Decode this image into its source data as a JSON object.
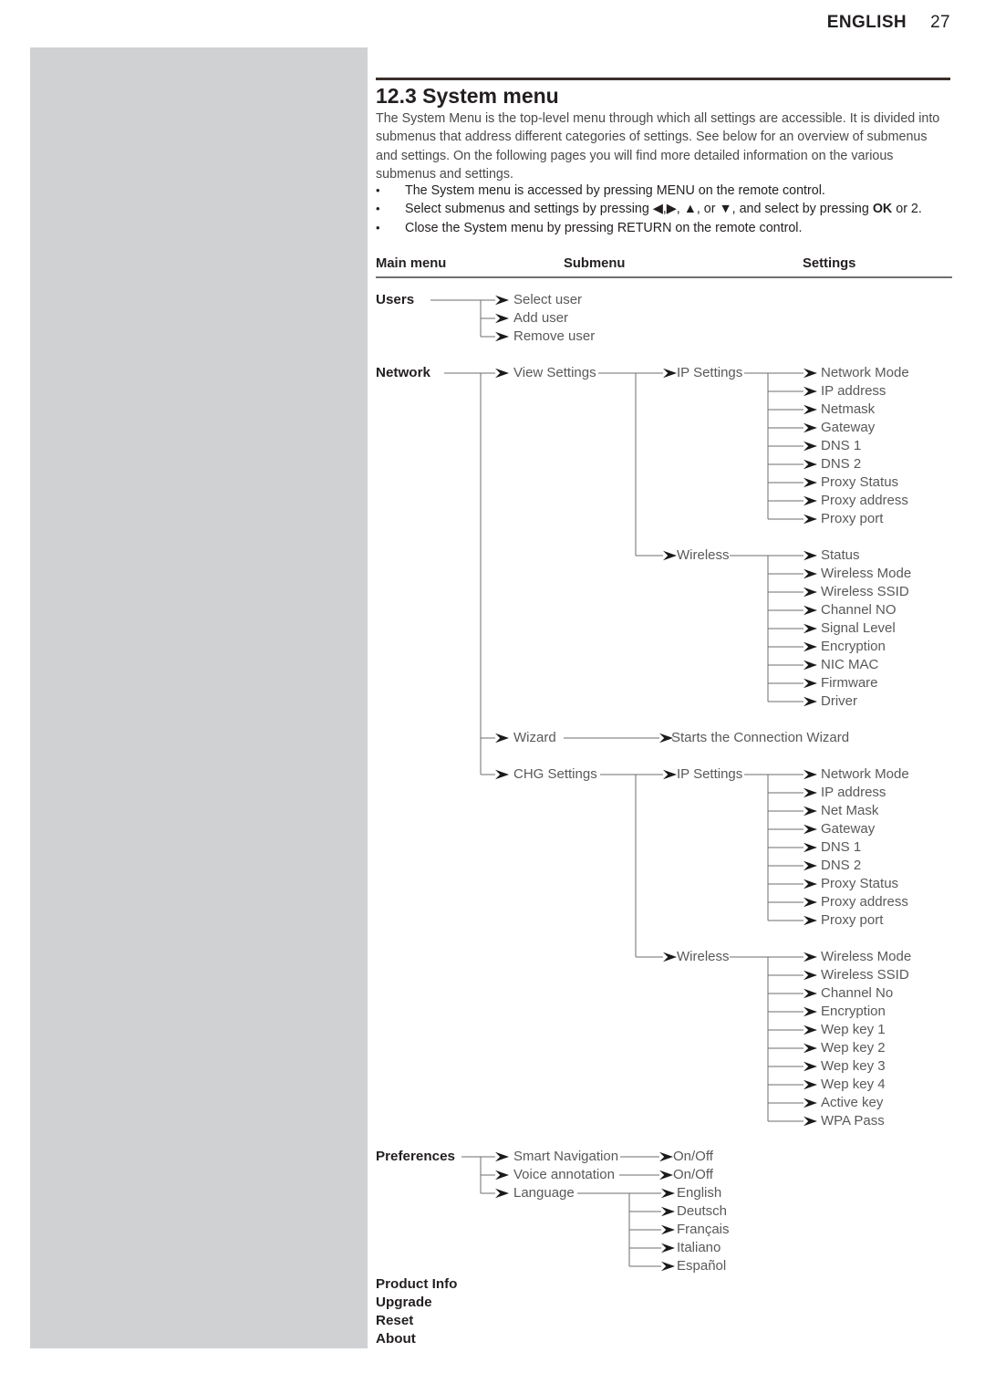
{
  "header": {
    "language_label": "ENGLISH",
    "page_number": "27"
  },
  "section": {
    "number_title": "12.3 System menu",
    "intro": "The System Menu is the top-level menu through which all settings are accessible. It is divided into submenus that address different categories of settings. See below for an overview of submenus and settings. On the following pages you will find more detailed information on the various submenus and settings.",
    "bullets": [
      {
        "bullet": "•",
        "html": "The System menu is accessed by pressing MENU on the remote control."
      },
      {
        "bullet": "•",
        "html": "Select submenus and settings by pressing ◀,▶, ▲, or ▼, and select by pressing <b>OK</b> or 2."
      },
      {
        "bullet": "•",
        "html": "Close the System menu by pressing RETURN on the remote control."
      }
    ]
  },
  "table": {
    "columns": [
      "Main menu",
      "Submenu",
      "Settings"
    ]
  },
  "menu_tree": {
    "users": {
      "label": "Users",
      "children": [
        "Select user",
        "Add user",
        "Remove user"
      ]
    },
    "network": {
      "label": "Network",
      "view_settings": {
        "label": "View Settings",
        "ip_settings": {
          "label": "IP Settings",
          "children": [
            "Network Mode",
            "IP address",
            "Netmask",
            "Gateway",
            "DNS 1",
            "DNS 2",
            "Proxy Status",
            "Proxy address",
            "Proxy port"
          ]
        },
        "wireless": {
          "label": "Wireless",
          "children": [
            "Status",
            "Wireless Mode",
            "Wireless SSID",
            "Channel NO",
            "Signal Level",
            "Encryption",
            "NIC MAC",
            "Firmware",
            "Driver"
          ]
        }
      },
      "wizard": {
        "label": "Wizard",
        "result": "Starts the Connection Wizard"
      },
      "chg_settings": {
        "label": "CHG Settings",
        "ip_settings": {
          "label": "IP Settings",
          "children": [
            "Network Mode",
            "IP address",
            "Net Mask",
            "Gateway",
            "DNS 1",
            "DNS 2",
            "Proxy Status",
            "Proxy address",
            "Proxy port"
          ]
        },
        "wireless": {
          "label": "Wireless",
          "children": [
            "Wireless Mode",
            "Wireless SSID",
            "Channel No",
            "Encryption",
            "Wep key 1",
            "Wep key 2",
            "Wep key 3",
            "Wep key 4",
            "Active key",
            "WPA Pass"
          ]
        }
      }
    },
    "preferences": {
      "label": "Preferences",
      "smart_navigation": {
        "label": "Smart Navigation",
        "value": "On/Off"
      },
      "voice_annotation": {
        "label": "Voice annotation",
        "value": "On/Off"
      },
      "language": {
        "label": "Language",
        "children": [
          "English",
          "Deutsch",
          "Français",
          "Italiano",
          "Español"
        ]
      }
    },
    "tail_items": [
      "Product Info",
      "Upgrade",
      "Reset",
      "About"
    ]
  },
  "colors": {
    "rule_dark": "#3b2f2b",
    "rule_gray": "#6f6f6f",
    "body_text": "#4a4a4a",
    "node_text": "#595959",
    "bold_text": "#231f20",
    "placeholder": "#d0d1d3",
    "connector": "#6e6e6e"
  }
}
